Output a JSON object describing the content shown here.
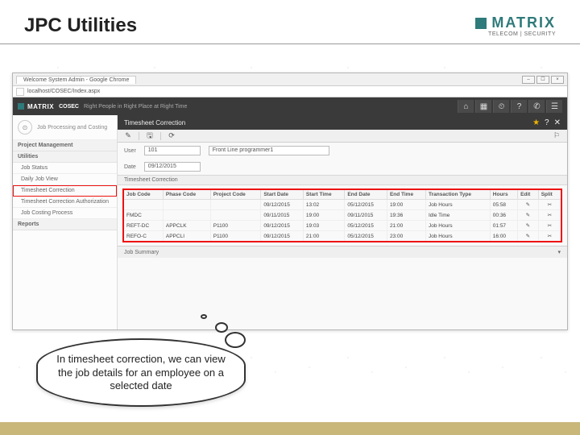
{
  "slide": {
    "title": "JPC Utilities"
  },
  "brand": {
    "name": "MATRIX",
    "sub": "TELECOM | SECURITY"
  },
  "browser": {
    "tab": "Welcome System Admin - Google Chrome",
    "url": "localhost/COSEC/Index.aspx",
    "win_min": "–",
    "win_max": "☐",
    "win_close": "×"
  },
  "app": {
    "logo_name": "MATRIX",
    "product": "COSEC",
    "tagline": "Right People in Right Place at Right Time",
    "hdr_icons": {
      "home": "⌂",
      "grid": "▦",
      "bell": "⏲",
      "help": "?",
      "phone": "✆",
      "user": "☰"
    }
  },
  "sidebar": {
    "module": "Job Processing and Costing",
    "sections": {
      "pm": "Project Management",
      "util": "Utilities",
      "reports": "Reports"
    },
    "items": {
      "job_status": "Job Status",
      "daily_job_view": "Daily Job View",
      "timesheet_correction": "Timesheet Correction",
      "tca": "Timesheet Correction Authorization",
      "jcp": "Job Costing Process"
    }
  },
  "panel": {
    "title": "Timesheet Correction",
    "right": {
      "star": "★",
      "help": "?",
      "close": "✕"
    },
    "toolbar": {
      "save": "✎",
      "export": "🖫",
      "refresh": "⟳",
      "flag": "⚐"
    },
    "user_label": "User",
    "user_id": "101",
    "user_name": "Front Line programmer1",
    "date_label": "Date",
    "date_value": "09/12/2015",
    "subgrid_title": "Timesheet Correction",
    "job_summary": "Job Summary",
    "summary_expand": "▾"
  },
  "table": {
    "headers": {
      "job_code": "Job Code",
      "phase_code": "Phase Code",
      "project_code": "Project Code",
      "start_date": "Start Date",
      "start_time": "Start Time",
      "end_date": "End Date",
      "end_time": "End Time",
      "tx_type": "Transaction Type",
      "hours": "Hours",
      "edit": "Edit",
      "split": "Split"
    },
    "rows": [
      {
        "job": "",
        "phase": "",
        "proj": "",
        "sd": "09/12/2015",
        "st": "13:02",
        "ed": "05/12/2015",
        "et": "19:00",
        "tx": "Job Hours",
        "hrs": "05:58",
        "edit": "✎",
        "split": "✂"
      },
      {
        "job": "FMDC",
        "phase": "",
        "proj": "",
        "sd": "09/11/2015",
        "st": "19:00",
        "ed": "09/11/2015",
        "et": "19:36",
        "tx": "Idle Time",
        "hrs": "00:36",
        "edit": "✎",
        "split": "✂"
      },
      {
        "job": "REFT-DC",
        "phase": "APPCLK",
        "proj": "P1100",
        "sd": "09/12/2015",
        "st": "19:03",
        "ed": "05/12/2015",
        "et": "21:00",
        "tx": "Job Hours",
        "hrs": "01:57",
        "edit": "✎",
        "split": "✂"
      },
      {
        "job": "REFO-C",
        "phase": "APPCLI",
        "proj": "P1100",
        "sd": "09/12/2015",
        "st": "21:00",
        "ed": "05/12/2015",
        "et": "23:00",
        "tx": "Job Hours",
        "hrs": "16:00",
        "edit": "✎",
        "split": "✂"
      }
    ]
  },
  "bubble": {
    "text": "In timesheet correction, we can view the job details for an employee on a selected date"
  }
}
